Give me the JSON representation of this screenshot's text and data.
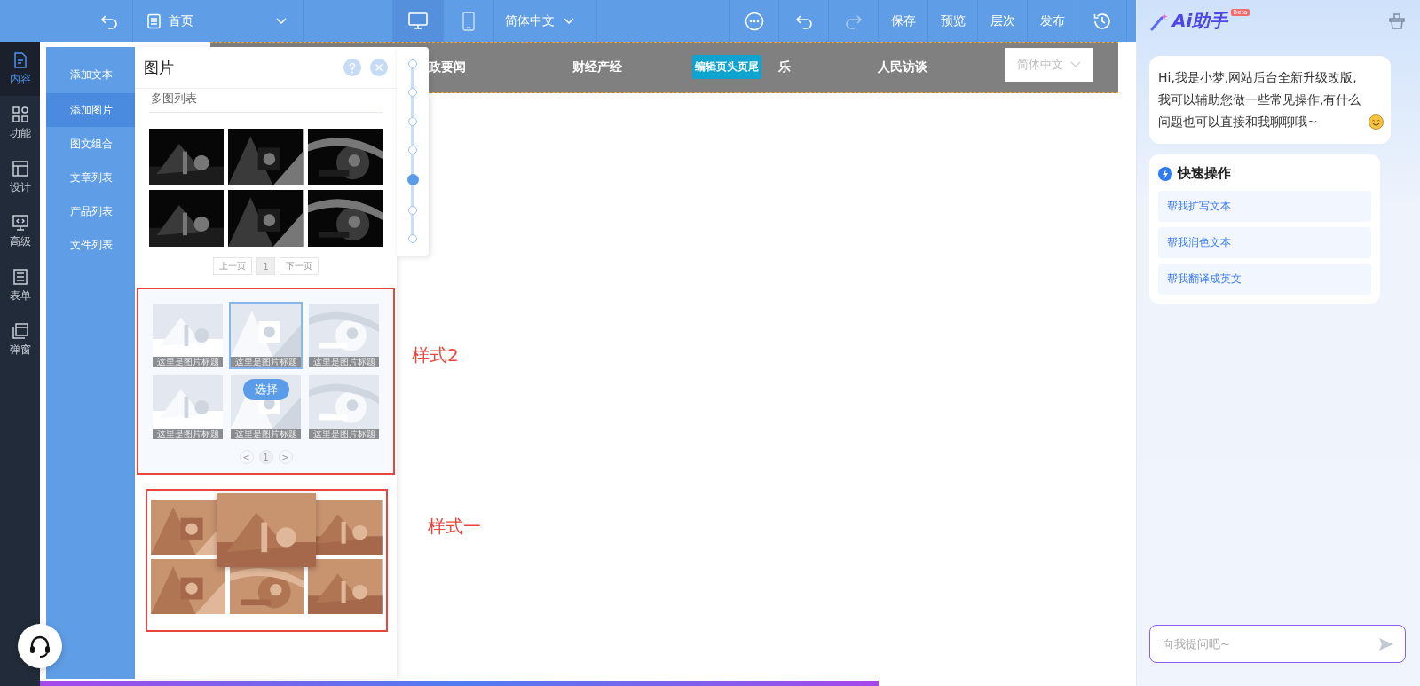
{
  "toolbar": {
    "page_select": "首页",
    "devices": [
      {
        "kind": "desktop",
        "selected": true
      },
      {
        "kind": "mobile",
        "selected": false
      }
    ],
    "language": "简体中文",
    "redo": {
      "disabled": true
    },
    "actions": [
      "保存",
      "预览",
      "层次",
      "发布"
    ]
  },
  "rail": [
    {
      "label": "内容",
      "kind": "content",
      "selected": true
    },
    {
      "label": "功能",
      "kind": "features",
      "selected": false
    },
    {
      "label": "设计",
      "kind": "design",
      "selected": false
    },
    {
      "label": "高级",
      "kind": "code",
      "selected": false
    },
    {
      "label": "表单",
      "kind": "form",
      "selected": false
    },
    {
      "label": "弹窗",
      "kind": "popup",
      "selected": false
    }
  ],
  "submenu": [
    {
      "label": "添加文本",
      "selected": false
    },
    {
      "label": "添加图片",
      "selected": true
    },
    {
      "label": "图文组合",
      "selected": false
    },
    {
      "label": "文章列表",
      "selected": false
    },
    {
      "label": "产品列表",
      "selected": false
    },
    {
      "label": "文件列表",
      "selected": false
    }
  ],
  "panel": {
    "title": "图片",
    "subtitle": "多图列表",
    "dark_gallery": {
      "pager": {
        "prev": "上一页",
        "page": "1",
        "next": "下一页"
      }
    },
    "style2": {
      "highlighted": true,
      "annotation": "样式2",
      "select_button": "选择",
      "pager": {
        "prev": "<",
        "page": "1",
        "next": ">"
      },
      "tiles": [
        {
          "kind": "picture",
          "caption": "这里是图片标题",
          "selected": false
        },
        {
          "kind": "picture",
          "caption": "这里是图片标题",
          "selected": true
        },
        {
          "kind": "picture",
          "caption": "这里是图片标题",
          "selected": false
        },
        {
          "kind": "picture",
          "caption": "这里是图片标题",
          "selected": false
        },
        {
          "kind": "picture",
          "caption": "这里是图片标题",
          "selected": false
        },
        {
          "kind": "picture",
          "caption": "这里是图片标题",
          "selected": false
        }
      ]
    },
    "style1": {
      "highlighted": true,
      "annotation": "样式一"
    }
  },
  "stepper": {
    "steps": [
      {
        "selected": false
      },
      {
        "selected": false
      },
      {
        "selected": false
      },
      {
        "selected": false
      },
      {
        "selected": true
      },
      {
        "selected": false
      },
      {
        "selected": false
      }
    ]
  },
  "canvas": {
    "nav": [
      "政要闻",
      "财经产经",
      "乐",
      "人民访谈"
    ],
    "edit_badge": "编辑页头页尾",
    "language": "简体中文"
  },
  "assistant": {
    "title": "Ai助手",
    "badge": "Beta",
    "greeting": "Hi,我是小梦,网站后台全新升级改版,我可以辅助您做一些常见操作,有什么问题也可以直接和我聊聊哦~",
    "quick_title": "快速操作",
    "quick_actions": [
      "帮我扩写文本",
      "帮我润色文本",
      "帮我翻译成英文"
    ],
    "input_placeholder": "向我提问吧~"
  }
}
